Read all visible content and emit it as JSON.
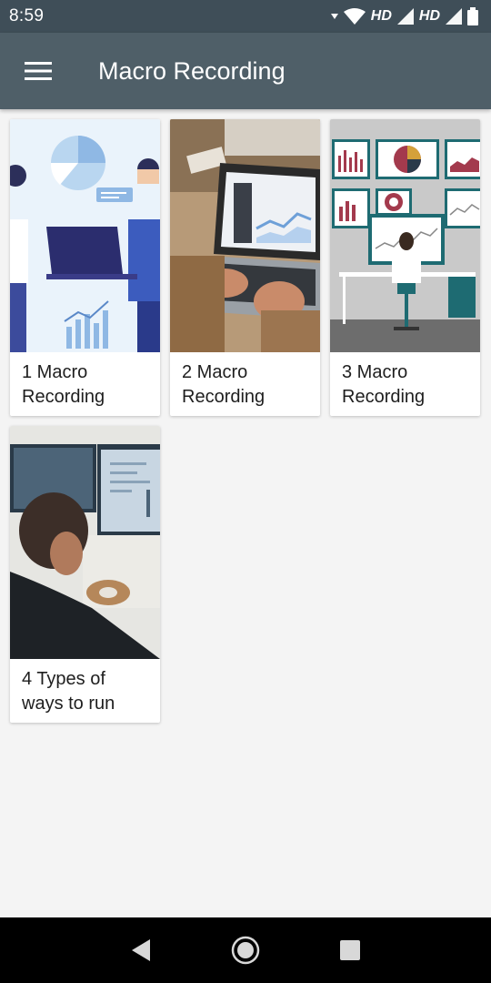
{
  "status": {
    "time": "8:59",
    "hd1": "HD",
    "hd2": "HD"
  },
  "appbar": {
    "title": "Macro Recording"
  },
  "cards": [
    {
      "title": "1 Macro Recording"
    },
    {
      "title": "2 Macro Recording"
    },
    {
      "title": "3 Macro Recording"
    },
    {
      "title": "4 Types of ways to run"
    }
  ],
  "colors": {
    "status_bar": "#3f4e58",
    "app_bar": "#4f5f68",
    "background": "#f4f4f4"
  },
  "icons": [
    "menu-icon",
    "wifi-icon",
    "signal-icon",
    "battery-icon",
    "back-icon",
    "home-icon",
    "recents-icon"
  ]
}
